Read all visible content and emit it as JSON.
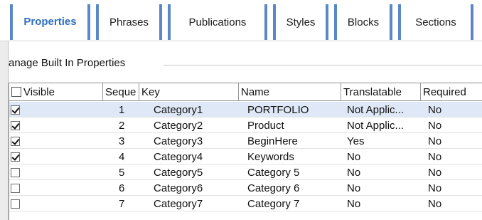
{
  "tabs": [
    {
      "label": "Properties",
      "active": true
    },
    {
      "label": "Phrases",
      "active": false
    },
    {
      "label": "Publications",
      "active": false
    },
    {
      "label": "Styles",
      "active": false
    },
    {
      "label": "Blocks",
      "active": false
    },
    {
      "label": "Sections",
      "active": false
    }
  ],
  "group": {
    "title": "anage Built In Properties"
  },
  "grid": {
    "columns": {
      "visible": "Visible",
      "sequence": "Seque",
      "key": "Key",
      "name": "Name",
      "translatable": "Translatable",
      "required": "Required"
    },
    "rows": [
      {
        "visible": true,
        "sequence": "1",
        "key": "Category1",
        "name": "PORTFOLIO",
        "translatable": "Not Applic...",
        "required": "No"
      },
      {
        "visible": true,
        "sequence": "2",
        "key": "Category2",
        "name": "Product",
        "translatable": "Not Applic...",
        "required": "No"
      },
      {
        "visible": true,
        "sequence": "3",
        "key": "Category3",
        "name": "BeginHere",
        "translatable": "Yes",
        "required": "No"
      },
      {
        "visible": true,
        "sequence": "4",
        "key": "Category4",
        "name": "Keywords",
        "translatable": "No",
        "required": "No"
      },
      {
        "visible": false,
        "sequence": "5",
        "key": "Category5",
        "name": "Category 5",
        "translatable": "No",
        "required": "No"
      },
      {
        "visible": false,
        "sequence": "6",
        "key": "Category6",
        "name": "Category 6",
        "translatable": "No",
        "required": "No"
      },
      {
        "visible": false,
        "sequence": "7",
        "key": "Category7",
        "name": "Category 7",
        "translatable": "No",
        "required": "No"
      }
    ]
  },
  "colors": {
    "accent": "#2f6fc0",
    "tab_border": "#5a87c8",
    "selected_row": "#dfe8f6"
  }
}
